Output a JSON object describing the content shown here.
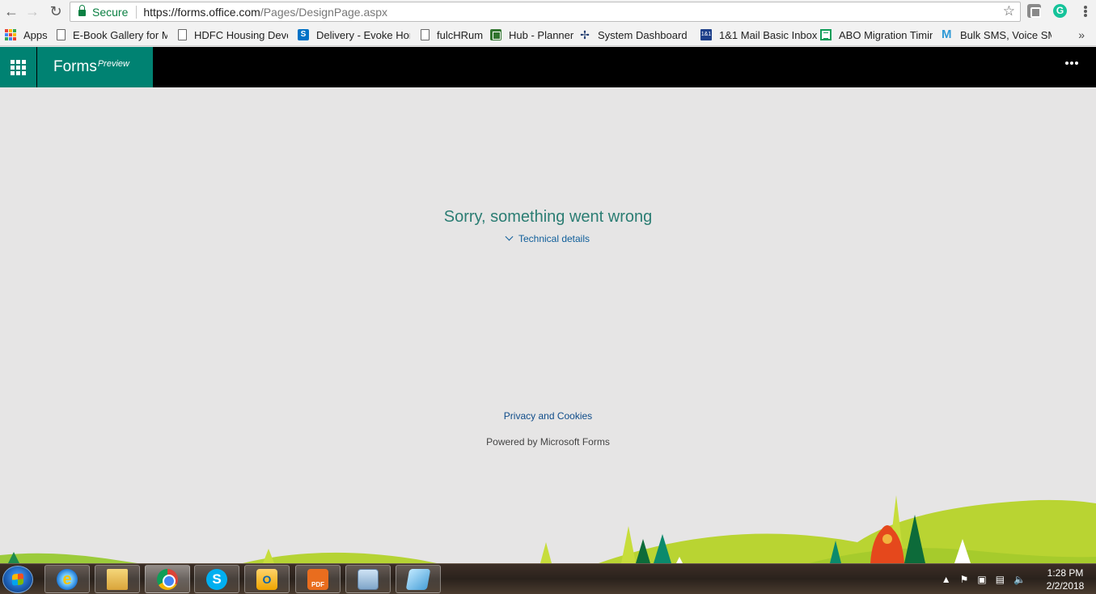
{
  "browser": {
    "secure_label": "Secure",
    "url_host": "https://forms.office.com",
    "url_path": "/Pages/DesignPage.aspx",
    "bookmarks": [
      {
        "label": "Apps",
        "icon": "apps-icon"
      },
      {
        "label": "E-Book Gallery for Mi",
        "icon": "page-icon"
      },
      {
        "label": "HDFC Housing Devel",
        "icon": "page-icon"
      },
      {
        "label": "Delivery - Evoke Hon",
        "icon": "sharepoint-icon"
      },
      {
        "label": "fulcHRum",
        "icon": "page-icon"
      },
      {
        "label": "Hub - Planner",
        "icon": "planner-icon"
      },
      {
        "label": "System Dashboard -",
        "icon": "dashboard-icon"
      },
      {
        "label": "1&1 Mail Basic Inbox",
        "icon": "mail-icon"
      },
      {
        "label": "ABO Migration Timin",
        "icon": "sheet-icon"
      },
      {
        "label": "Bulk SMS, Voice SMS",
        "icon": "sms-icon"
      }
    ],
    "more_label": "»"
  },
  "app": {
    "brand_name": "Forms",
    "brand_tag": "Preview"
  },
  "error": {
    "title": "Sorry, something went wrong",
    "details_label": "Technical details"
  },
  "footer": {
    "privacy_label": "Privacy and Cookies",
    "powered_label": "Powered by Microsoft Forms"
  },
  "taskbar": {
    "time": "1:28 PM",
    "date": "2/2/2018",
    "pdf_label": "PDF"
  },
  "colors": {
    "accent": "#008272",
    "error_text": "#2b7d73",
    "link": "#0f5e9a",
    "page_bg": "#e6e5e5"
  }
}
